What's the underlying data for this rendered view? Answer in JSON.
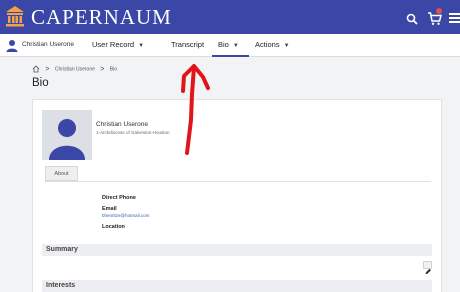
{
  "header": {
    "brand": "CAPERNAUM",
    "logo_icon": "building-columns-icon",
    "search_icon": "search-icon",
    "cart_icon": "cart-icon",
    "menu_icon": "hamburger-menu-icon",
    "bg_color": "#3b47a6"
  },
  "nav": {
    "user_name": "Christian Userone",
    "items": [
      {
        "label": "User Record",
        "has_caret": true
      },
      {
        "label": "Transcript",
        "has_caret": false
      },
      {
        "label": "Bio",
        "has_caret": true,
        "active": true
      },
      {
        "label": "Actions",
        "has_caret": true
      }
    ],
    "accent_color": "#3b47a6"
  },
  "breadcrumb": {
    "items": [
      "Christian Userone",
      "Bio"
    ]
  },
  "page": {
    "title": "Bio"
  },
  "profile": {
    "name": "Christian Userone",
    "organization": "1-Archdiocese of Galveston-Houston"
  },
  "tabs": [
    "About"
  ],
  "contact": {
    "direct_phone_label": "Direct Phone",
    "email_label": "Email",
    "email_value": "bhenritze@hotmail.com",
    "location_label": "Location"
  },
  "sections": {
    "summary": "Summary",
    "interests": "Interests"
  },
  "annotation": {
    "arrow_color": "#e0141b"
  }
}
